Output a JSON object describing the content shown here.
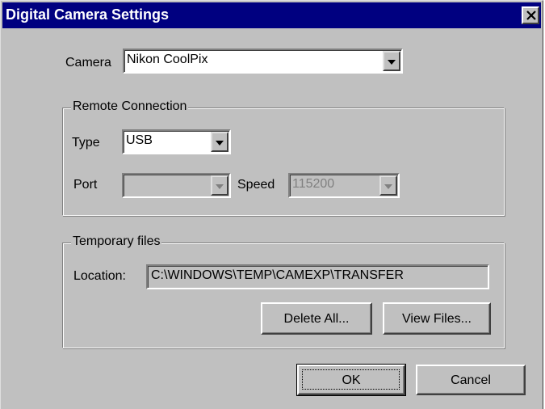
{
  "window": {
    "title": "Digital Camera Settings",
    "close_icon": "close-icon"
  },
  "camera": {
    "label": "Camera",
    "value": "Nikon CoolPix"
  },
  "remote_connection": {
    "legend": "Remote Connection",
    "type_label": "Type",
    "type_value": "USB",
    "port_label": "Port",
    "port_value": "",
    "speed_label": "Speed",
    "speed_value": "115200"
  },
  "temporary_files": {
    "legend": "Temporary files",
    "location_label": "Location:",
    "location_value": "C:\\WINDOWS\\TEMP\\CAMEXP\\TRANSFER",
    "delete_all_label": "Delete All...",
    "view_files_label": "View Files..."
  },
  "buttons": {
    "ok_label": "OK",
    "cancel_label": "Cancel"
  },
  "colors": {
    "titlebar": "#000080",
    "face": "#c0c0c0",
    "disabled_text": "#808080"
  }
}
